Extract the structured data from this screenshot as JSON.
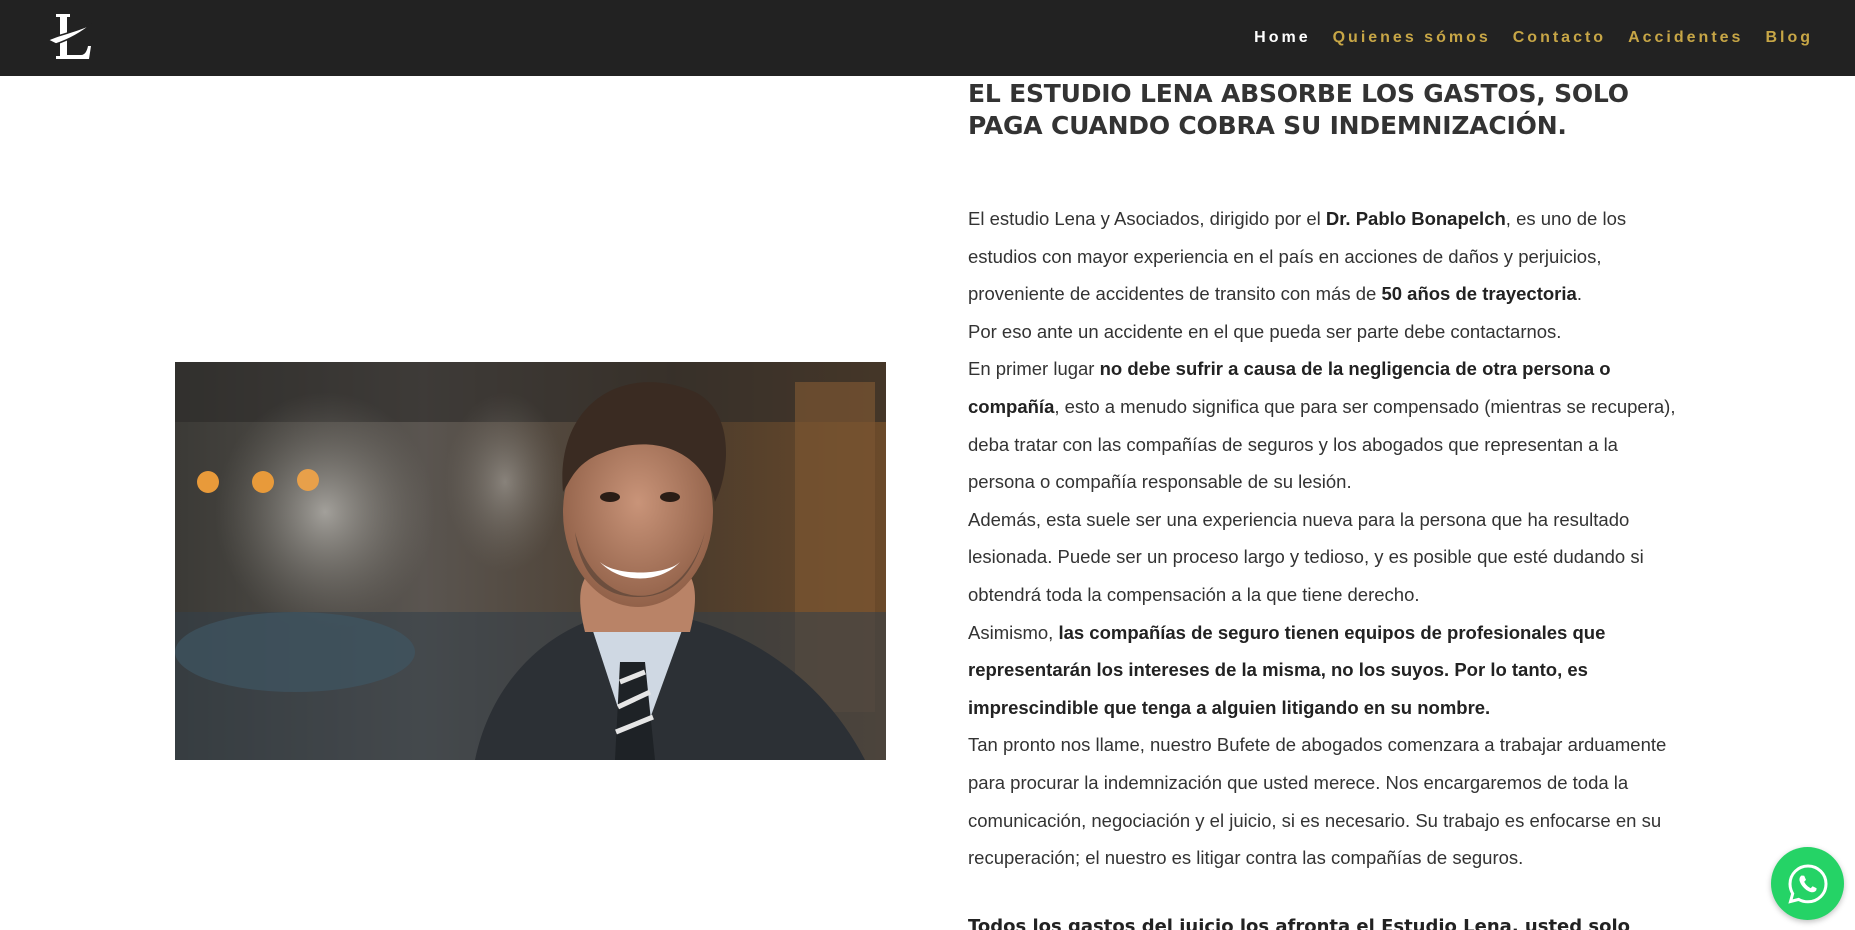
{
  "nav": {
    "logo_letter": "L",
    "items": [
      {
        "label": "Home",
        "active": true
      },
      {
        "label": "Quienes sómos",
        "active": false
      },
      {
        "label": "Contacto",
        "active": false
      },
      {
        "label": "Accidentes",
        "active": false
      },
      {
        "label": "Blog",
        "active": false
      }
    ],
    "active_color": "#ffffff",
    "accent_color": "#c7a646",
    "background": "#222222"
  },
  "hero": {
    "image_alt_icon": "smiling-lawyer-photo",
    "headline": "EL ESTUDIO LENA ABSORBE LOS GASTOS, SOLO PAGA CUANDO COBRA SU INDEMNIZACIÓN."
  },
  "content": {
    "p1_a": "El estudio Lena y Asociados, dirigido por el ",
    "p1_b": "Dr. Pablo Bonapelch",
    "p1_c": ", es uno de los estudios con mayor experiencia en el país en acciones de daños y perjuicios, proveniente de accidentes de transito con más de ",
    "p1_d": "50 años de trayectoria",
    "p1_e": ".",
    "p2": "Por eso ante un accidente en el que pueda ser parte debe contactarnos.",
    "p3_a": "En primer lugar ",
    "p3_b": "no debe sufrir a causa de la negligencia de otra persona o compañía",
    "p3_c": ", esto a menudo significa que para ser compensado (mientras se recupera), deba tratar con las compañías de seguros y los abogados que representan a la persona o compañía responsable de su lesión.",
    "p4": "Además, esta suele ser una experiencia nueva para la persona que ha resultado lesionada. Puede ser un proceso largo y tedioso, y es posible que esté dudando si obtendrá toda la compensación a la que tiene derecho.",
    "p5_a": "Asimismo, ",
    "p5_b": "las compañías de seguro tienen equipos de profesionales que representarán los intereses de la misma, no los suyos. Por lo tanto, es imprescindible que tenga a alguien litigando en su nombre.",
    "p6": "Tan pronto nos llame, nuestro Bufete de abogados comenzara a trabajar arduamente para procurar la indemnización que usted merece. Nos encargaremos de toda la comunicación, negociación y el juicio, si es necesario. Su trabajo es enfocarse en su recuperación; el nuestro es litigar contra las compañías de seguros.",
    "closing": "Todos los gastos del juicio los afronta el Estudio Lena, usted solo paga cuando termine el litigio y cobre su indemnización."
  },
  "whatsapp": {
    "icon": "whatsapp-icon",
    "color": "#25d366"
  }
}
